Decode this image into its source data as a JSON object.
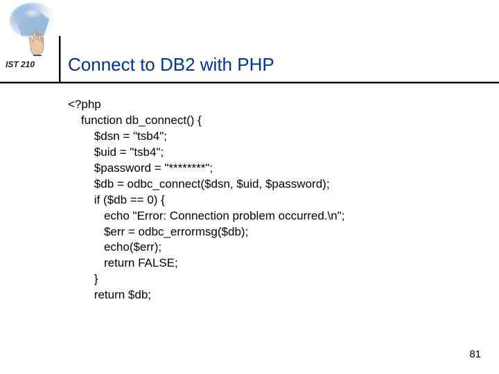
{
  "course_label": "IST 210",
  "title": "Connect to DB2 with PHP",
  "code_lines": [
    "<?php",
    "    function db_connect() {",
    "        $dsn = \"tsb4\";",
    "        $uid = \"tsb4\";",
    "        $password = \"********\";",
    "        $db = odbc_connect($dsn, $uid, $password);",
    "        if ($db == 0) {",
    "           echo \"Error: Connection problem occurred.\\n\";",
    "           $err = odbc_errormsg($db);",
    "           echo($err);",
    "           return FALSE;",
    "        }",
    "        return $db;"
  ],
  "page_number": "81"
}
